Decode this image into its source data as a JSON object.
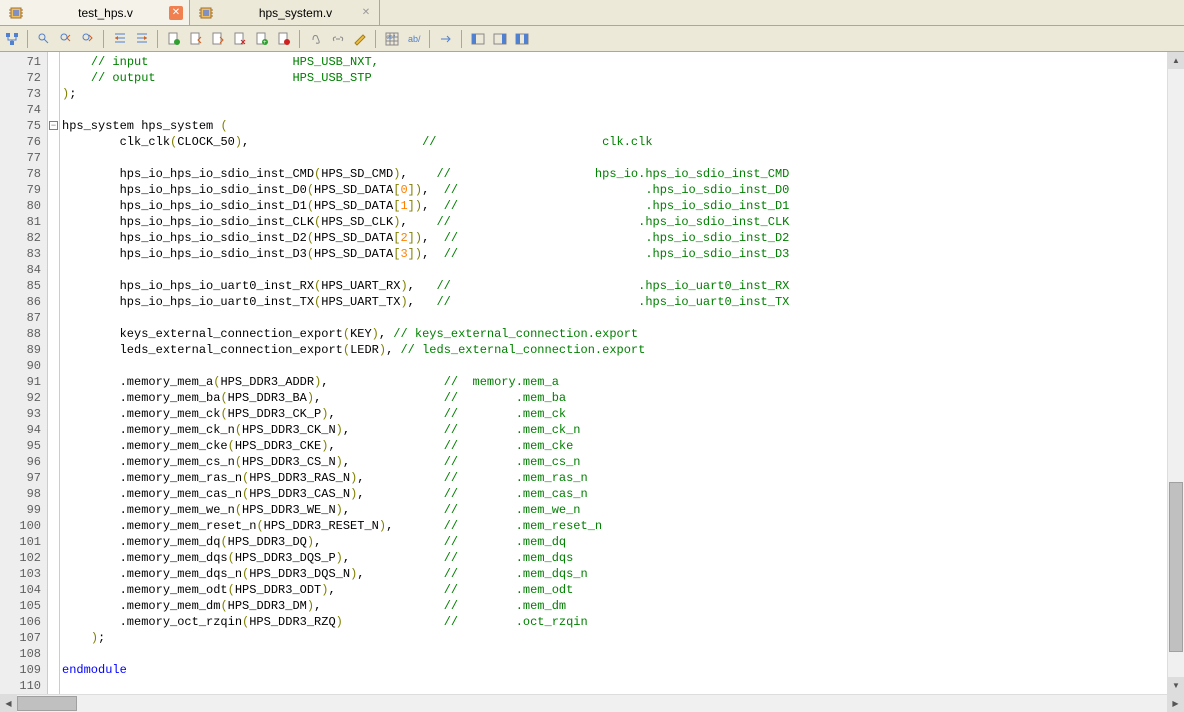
{
  "tabs": [
    {
      "name": "test_hps.v",
      "active": true
    },
    {
      "name": "hps_system.v",
      "active": false
    }
  ],
  "toolbar_icons": [
    "document-tree",
    "find",
    "find-prev",
    "find-next",
    "indent-left",
    "indent-right",
    "bookmark-toggle",
    "bookmark-prev",
    "bookmark-next",
    "bookmark-clear",
    "bookmark-add",
    "bookmark-rem",
    "attach",
    "link",
    "edit",
    "grid",
    "text-ab",
    "arrow-right",
    "panel-left",
    "panel-right",
    "panel-both"
  ],
  "first_line_number": 71,
  "fold_at_line": 75,
  "code_lines": [
    {
      "seg": [
        {
          "c": "c",
          "t": "// input                    HPS_USB_NXT,"
        }
      ],
      "indent": 4
    },
    {
      "seg": [
        {
          "c": "c",
          "t": "// output                   HPS_USB_STP"
        }
      ],
      "indent": 4
    },
    {
      "seg": [
        {
          "c": "b",
          "t": ")"
        },
        {
          "c": "t",
          "t": ";"
        }
      ],
      "indent": 0
    },
    {
      "seg": [],
      "indent": 0
    },
    {
      "seg": [
        {
          "c": "t",
          "t": "hps_system hps_system "
        },
        {
          "c": "b",
          "t": "("
        }
      ],
      "indent": 0
    },
    {
      "seg": [
        {
          "c": "t",
          "t": "clk_clk"
        },
        {
          "c": "b",
          "t": "("
        },
        {
          "c": "t",
          "t": "CLOCK_50"
        },
        {
          "c": "b",
          "t": ")"
        },
        {
          "c": "t",
          "t": ",                        "
        },
        {
          "c": "c",
          "t": "//                       clk.clk"
        }
      ],
      "indent": 8
    },
    {
      "seg": [],
      "indent": 0
    },
    {
      "seg": [
        {
          "c": "t",
          "t": "hps_io_hps_io_sdio_inst_CMD"
        },
        {
          "c": "b",
          "t": "("
        },
        {
          "c": "t",
          "t": "HPS_SD_CMD"
        },
        {
          "c": "b",
          "t": ")"
        },
        {
          "c": "t",
          "t": ",    "
        },
        {
          "c": "c",
          "t": "//                    hps_io.hps_io_sdio_inst_CMD"
        }
      ],
      "indent": 8
    },
    {
      "seg": [
        {
          "c": "t",
          "t": "hps_io_hps_io_sdio_inst_D0"
        },
        {
          "c": "b",
          "t": "("
        },
        {
          "c": "t",
          "t": "HPS_SD_DATA"
        },
        {
          "c": "b",
          "t": "["
        },
        {
          "c": "n",
          "t": "0"
        },
        {
          "c": "b",
          "t": "])"
        },
        {
          "c": "t",
          "t": ",  "
        },
        {
          "c": "c",
          "t": "//                          .hps_io_sdio_inst_D0"
        }
      ],
      "indent": 8
    },
    {
      "seg": [
        {
          "c": "t",
          "t": "hps_io_hps_io_sdio_inst_D1"
        },
        {
          "c": "b",
          "t": "("
        },
        {
          "c": "t",
          "t": "HPS_SD_DATA"
        },
        {
          "c": "b",
          "t": "["
        },
        {
          "c": "n",
          "t": "1"
        },
        {
          "c": "b",
          "t": "])"
        },
        {
          "c": "t",
          "t": ",  "
        },
        {
          "c": "c",
          "t": "//                          .hps_io_sdio_inst_D1"
        }
      ],
      "indent": 8
    },
    {
      "seg": [
        {
          "c": "t",
          "t": "hps_io_hps_io_sdio_inst_CLK"
        },
        {
          "c": "b",
          "t": "("
        },
        {
          "c": "t",
          "t": "HPS_SD_CLK"
        },
        {
          "c": "b",
          "t": ")"
        },
        {
          "c": "t",
          "t": ",    "
        },
        {
          "c": "c",
          "t": "//                          .hps_io_sdio_inst_CLK"
        }
      ],
      "indent": 8
    },
    {
      "seg": [
        {
          "c": "t",
          "t": "hps_io_hps_io_sdio_inst_D2"
        },
        {
          "c": "b",
          "t": "("
        },
        {
          "c": "t",
          "t": "HPS_SD_DATA"
        },
        {
          "c": "b",
          "t": "["
        },
        {
          "c": "n",
          "t": "2"
        },
        {
          "c": "b",
          "t": "])"
        },
        {
          "c": "t",
          "t": ",  "
        },
        {
          "c": "c",
          "t": "//                          .hps_io_sdio_inst_D2"
        }
      ],
      "indent": 8
    },
    {
      "seg": [
        {
          "c": "t",
          "t": "hps_io_hps_io_sdio_inst_D3"
        },
        {
          "c": "b",
          "t": "("
        },
        {
          "c": "t",
          "t": "HPS_SD_DATA"
        },
        {
          "c": "b",
          "t": "["
        },
        {
          "c": "n",
          "t": "3"
        },
        {
          "c": "b",
          "t": "])"
        },
        {
          "c": "t",
          "t": ",  "
        },
        {
          "c": "c",
          "t": "//                          .hps_io_sdio_inst_D3"
        }
      ],
      "indent": 8
    },
    {
      "seg": [],
      "indent": 0
    },
    {
      "seg": [
        {
          "c": "t",
          "t": "hps_io_hps_io_uart0_inst_RX"
        },
        {
          "c": "b",
          "t": "("
        },
        {
          "c": "t",
          "t": "HPS_UART_RX"
        },
        {
          "c": "b",
          "t": ")"
        },
        {
          "c": "t",
          "t": ",   "
        },
        {
          "c": "c",
          "t": "//                          .hps_io_uart0_inst_RX"
        }
      ],
      "indent": 8
    },
    {
      "seg": [
        {
          "c": "t",
          "t": "hps_io_hps_io_uart0_inst_TX"
        },
        {
          "c": "b",
          "t": "("
        },
        {
          "c": "t",
          "t": "HPS_UART_TX"
        },
        {
          "c": "b",
          "t": ")"
        },
        {
          "c": "t",
          "t": ",   "
        },
        {
          "c": "c",
          "t": "//                          .hps_io_uart0_inst_TX"
        }
      ],
      "indent": 8
    },
    {
      "seg": [],
      "indent": 0
    },
    {
      "seg": [
        {
          "c": "t",
          "t": "keys_external_connection_export"
        },
        {
          "c": "b",
          "t": "("
        },
        {
          "c": "t",
          "t": "KEY"
        },
        {
          "c": "b",
          "t": ")"
        },
        {
          "c": "t",
          "t": ", "
        },
        {
          "c": "c",
          "t": "// keys_external_connection.export"
        }
      ],
      "indent": 8
    },
    {
      "seg": [
        {
          "c": "t",
          "t": "leds_external_connection_export"
        },
        {
          "c": "b",
          "t": "("
        },
        {
          "c": "t",
          "t": "LEDR"
        },
        {
          "c": "b",
          "t": ")"
        },
        {
          "c": "t",
          "t": ", "
        },
        {
          "c": "c",
          "t": "// leds_external_connection.export"
        }
      ],
      "indent": 8
    },
    {
      "seg": [],
      "indent": 0
    },
    {
      "seg": [
        {
          "c": "t",
          "t": ".memory_mem_a"
        },
        {
          "c": "b",
          "t": "("
        },
        {
          "c": "t",
          "t": "HPS_DDR3_ADDR"
        },
        {
          "c": "b",
          "t": ")"
        },
        {
          "c": "t",
          "t": ",                "
        },
        {
          "c": "c",
          "t": "//  memory.mem_a"
        }
      ],
      "indent": 8
    },
    {
      "seg": [
        {
          "c": "t",
          "t": ".memory_mem_ba"
        },
        {
          "c": "b",
          "t": "("
        },
        {
          "c": "t",
          "t": "HPS_DDR3_BA"
        },
        {
          "c": "b",
          "t": ")"
        },
        {
          "c": "t",
          "t": ",                 "
        },
        {
          "c": "c",
          "t": "//        .mem_ba"
        }
      ],
      "indent": 8
    },
    {
      "seg": [
        {
          "c": "t",
          "t": ".memory_mem_ck"
        },
        {
          "c": "b",
          "t": "("
        },
        {
          "c": "t",
          "t": "HPS_DDR3_CK_P"
        },
        {
          "c": "b",
          "t": ")"
        },
        {
          "c": "t",
          "t": ",               "
        },
        {
          "c": "c",
          "t": "//        .mem_ck"
        }
      ],
      "indent": 8
    },
    {
      "seg": [
        {
          "c": "t",
          "t": ".memory_mem_ck_n"
        },
        {
          "c": "b",
          "t": "("
        },
        {
          "c": "t",
          "t": "HPS_DDR3_CK_N"
        },
        {
          "c": "b",
          "t": ")"
        },
        {
          "c": "t",
          "t": ",             "
        },
        {
          "c": "c",
          "t": "//        .mem_ck_n"
        }
      ],
      "indent": 8
    },
    {
      "seg": [
        {
          "c": "t",
          "t": ".memory_mem_cke"
        },
        {
          "c": "b",
          "t": "("
        },
        {
          "c": "t",
          "t": "HPS_DDR3_CKE"
        },
        {
          "c": "b",
          "t": ")"
        },
        {
          "c": "t",
          "t": ",               "
        },
        {
          "c": "c",
          "t": "//        .mem_cke"
        }
      ],
      "indent": 8
    },
    {
      "seg": [
        {
          "c": "t",
          "t": ".memory_mem_cs_n"
        },
        {
          "c": "b",
          "t": "("
        },
        {
          "c": "t",
          "t": "HPS_DDR3_CS_N"
        },
        {
          "c": "b",
          "t": ")"
        },
        {
          "c": "t",
          "t": ",             "
        },
        {
          "c": "c",
          "t": "//        .mem_cs_n"
        }
      ],
      "indent": 8
    },
    {
      "seg": [
        {
          "c": "t",
          "t": ".memory_mem_ras_n"
        },
        {
          "c": "b",
          "t": "("
        },
        {
          "c": "t",
          "t": "HPS_DDR3_RAS_N"
        },
        {
          "c": "b",
          "t": ")"
        },
        {
          "c": "t",
          "t": ",           "
        },
        {
          "c": "c",
          "t": "//        .mem_ras_n"
        }
      ],
      "indent": 8
    },
    {
      "seg": [
        {
          "c": "t",
          "t": ".memory_mem_cas_n"
        },
        {
          "c": "b",
          "t": "("
        },
        {
          "c": "t",
          "t": "HPS_DDR3_CAS_N"
        },
        {
          "c": "b",
          "t": ")"
        },
        {
          "c": "t",
          "t": ",           "
        },
        {
          "c": "c",
          "t": "//        .mem_cas_n"
        }
      ],
      "indent": 8
    },
    {
      "seg": [
        {
          "c": "t",
          "t": ".memory_mem_we_n"
        },
        {
          "c": "b",
          "t": "("
        },
        {
          "c": "t",
          "t": "HPS_DDR3_WE_N"
        },
        {
          "c": "b",
          "t": ")"
        },
        {
          "c": "t",
          "t": ",             "
        },
        {
          "c": "c",
          "t": "//        .mem_we_n"
        }
      ],
      "indent": 8
    },
    {
      "seg": [
        {
          "c": "t",
          "t": ".memory_mem_reset_n"
        },
        {
          "c": "b",
          "t": "("
        },
        {
          "c": "t",
          "t": "HPS_DDR3_RESET_N"
        },
        {
          "c": "b",
          "t": ")"
        },
        {
          "c": "t",
          "t": ",       "
        },
        {
          "c": "c",
          "t": "//        .mem_reset_n"
        }
      ],
      "indent": 8
    },
    {
      "seg": [
        {
          "c": "t",
          "t": ".memory_mem_dq"
        },
        {
          "c": "b",
          "t": "("
        },
        {
          "c": "t",
          "t": "HPS_DDR3_DQ"
        },
        {
          "c": "b",
          "t": ")"
        },
        {
          "c": "t",
          "t": ",                 "
        },
        {
          "c": "c",
          "t": "//        .mem_dq"
        }
      ],
      "indent": 8
    },
    {
      "seg": [
        {
          "c": "t",
          "t": ".memory_mem_dqs"
        },
        {
          "c": "b",
          "t": "("
        },
        {
          "c": "t",
          "t": "HPS_DDR3_DQS_P"
        },
        {
          "c": "b",
          "t": ")"
        },
        {
          "c": "t",
          "t": ",             "
        },
        {
          "c": "c",
          "t": "//        .mem_dqs"
        }
      ],
      "indent": 8
    },
    {
      "seg": [
        {
          "c": "t",
          "t": ".memory_mem_dqs_n"
        },
        {
          "c": "b",
          "t": "("
        },
        {
          "c": "t",
          "t": "HPS_DDR3_DQS_N"
        },
        {
          "c": "b",
          "t": ")"
        },
        {
          "c": "t",
          "t": ",           "
        },
        {
          "c": "c",
          "t": "//        .mem_dqs_n"
        }
      ],
      "indent": 8
    },
    {
      "seg": [
        {
          "c": "t",
          "t": ".memory_mem_odt"
        },
        {
          "c": "b",
          "t": "("
        },
        {
          "c": "t",
          "t": "HPS_DDR3_ODT"
        },
        {
          "c": "b",
          "t": ")"
        },
        {
          "c": "t",
          "t": ",               "
        },
        {
          "c": "c",
          "t": "//        .mem_odt"
        }
      ],
      "indent": 8
    },
    {
      "seg": [
        {
          "c": "t",
          "t": ".memory_mem_dm"
        },
        {
          "c": "b",
          "t": "("
        },
        {
          "c": "t",
          "t": "HPS_DDR3_DM"
        },
        {
          "c": "b",
          "t": ")"
        },
        {
          "c": "t",
          "t": ",                 "
        },
        {
          "c": "c",
          "t": "//        .mem_dm"
        }
      ],
      "indent": 8
    },
    {
      "seg": [
        {
          "c": "t",
          "t": ".memory_oct_rzqin"
        },
        {
          "c": "b",
          "t": "("
        },
        {
          "c": "t",
          "t": "HPS_DDR3_RZQ"
        },
        {
          "c": "b",
          "t": ")"
        },
        {
          "c": "t",
          "t": "              "
        },
        {
          "c": "c",
          "t": "//        .oct_rzqin"
        }
      ],
      "indent": 8
    },
    {
      "seg": [
        {
          "c": "b",
          "t": ")"
        },
        {
          "c": "t",
          "t": ";"
        }
      ],
      "indent": 4
    },
    {
      "seg": [],
      "indent": 0
    },
    {
      "seg": [
        {
          "c": "k",
          "t": "endmodule"
        }
      ],
      "indent": 0
    },
    {
      "seg": [],
      "indent": 0
    }
  ]
}
